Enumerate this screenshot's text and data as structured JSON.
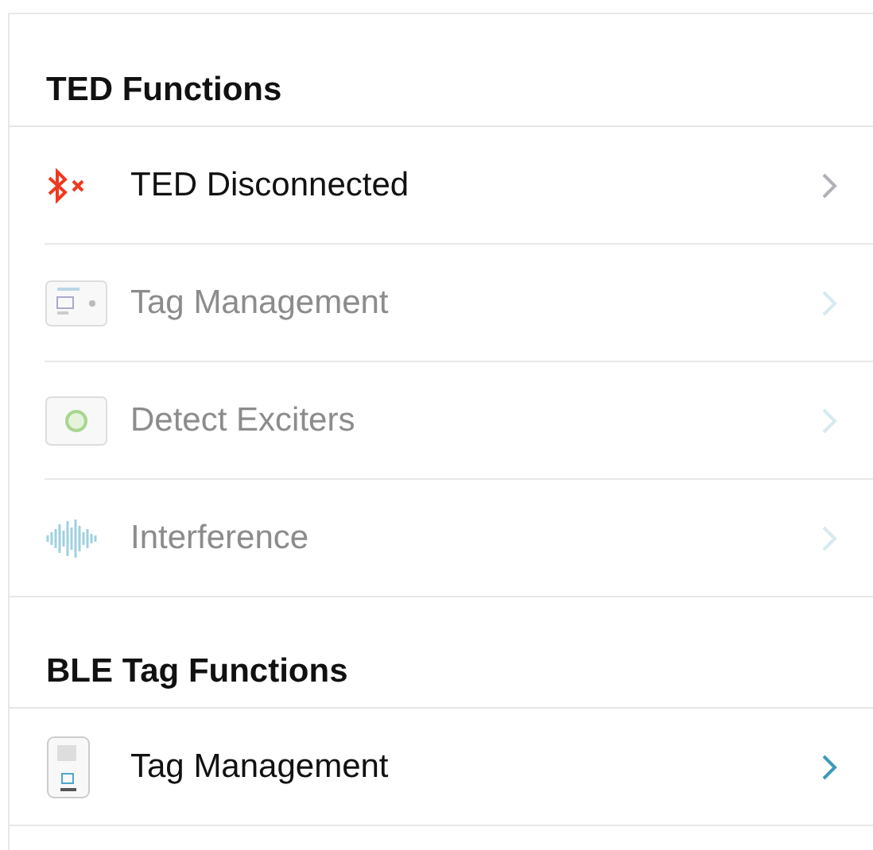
{
  "sections": [
    {
      "title": "TED Functions",
      "items": [
        {
          "label": "TED Disconnected",
          "kind": "status",
          "disabled": false
        },
        {
          "label": "Tag Management",
          "kind": "tag",
          "disabled": true
        },
        {
          "label": "Detect Exciters",
          "kind": "exciter",
          "disabled": true
        },
        {
          "label": "Interference",
          "kind": "interference",
          "disabled": true
        }
      ]
    },
    {
      "title": "BLE Tag Functions",
      "items": [
        {
          "label": "Tag Management",
          "kind": "device",
          "disabled": false
        }
      ]
    }
  ]
}
